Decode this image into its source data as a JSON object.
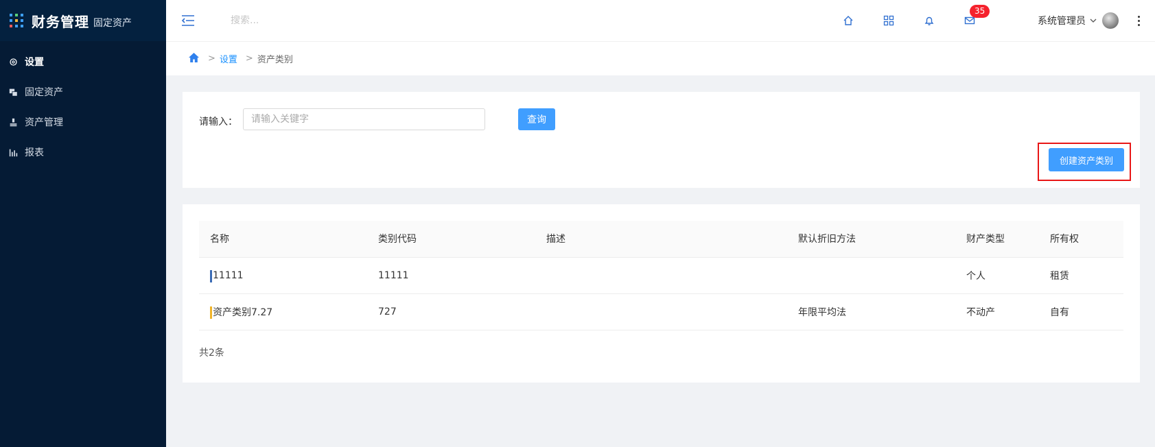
{
  "brand": {
    "title": "财务管理",
    "subtitle": "固定资产"
  },
  "sidebar": {
    "items": [
      {
        "label": "设置",
        "icon": "gear-icon",
        "active": true
      },
      {
        "label": "固定资产",
        "icon": "assets-icon",
        "active": false
      },
      {
        "label": "资产管理",
        "icon": "manage-icon",
        "active": false
      },
      {
        "label": "报表",
        "icon": "bar-chart-icon",
        "active": false
      }
    ]
  },
  "topbar": {
    "search_placeholder": "搜索...",
    "mail_badge": "35",
    "user_name": "系统管理员"
  },
  "breadcrumb": {
    "sep": ">",
    "items": [
      "设置",
      "资产类别"
    ]
  },
  "search_form": {
    "label": "请输入：",
    "placeholder": "请输入关键字",
    "query_label": "查询",
    "create_label": "创建资产类别"
  },
  "table": {
    "headers": [
      "名称",
      "类别代码",
      "描述",
      "默认折旧方法",
      "财产类型",
      "所有权"
    ],
    "rows": [
      {
        "name": "11111",
        "code": "11111",
        "desc": "",
        "method": "",
        "type": "个人",
        "owner": "租赁",
        "color": "#3b6bb5"
      },
      {
        "name": "资产类别7.27",
        "code": "727",
        "desc": "",
        "method": "年限平均法",
        "type": "不动产",
        "owner": "自有",
        "color": "#f0b429"
      }
    ],
    "total": "共2条"
  },
  "colors": {
    "sidebar_bg": "#051b35",
    "primary": "#409eff",
    "highlight": "#e81616"
  }
}
